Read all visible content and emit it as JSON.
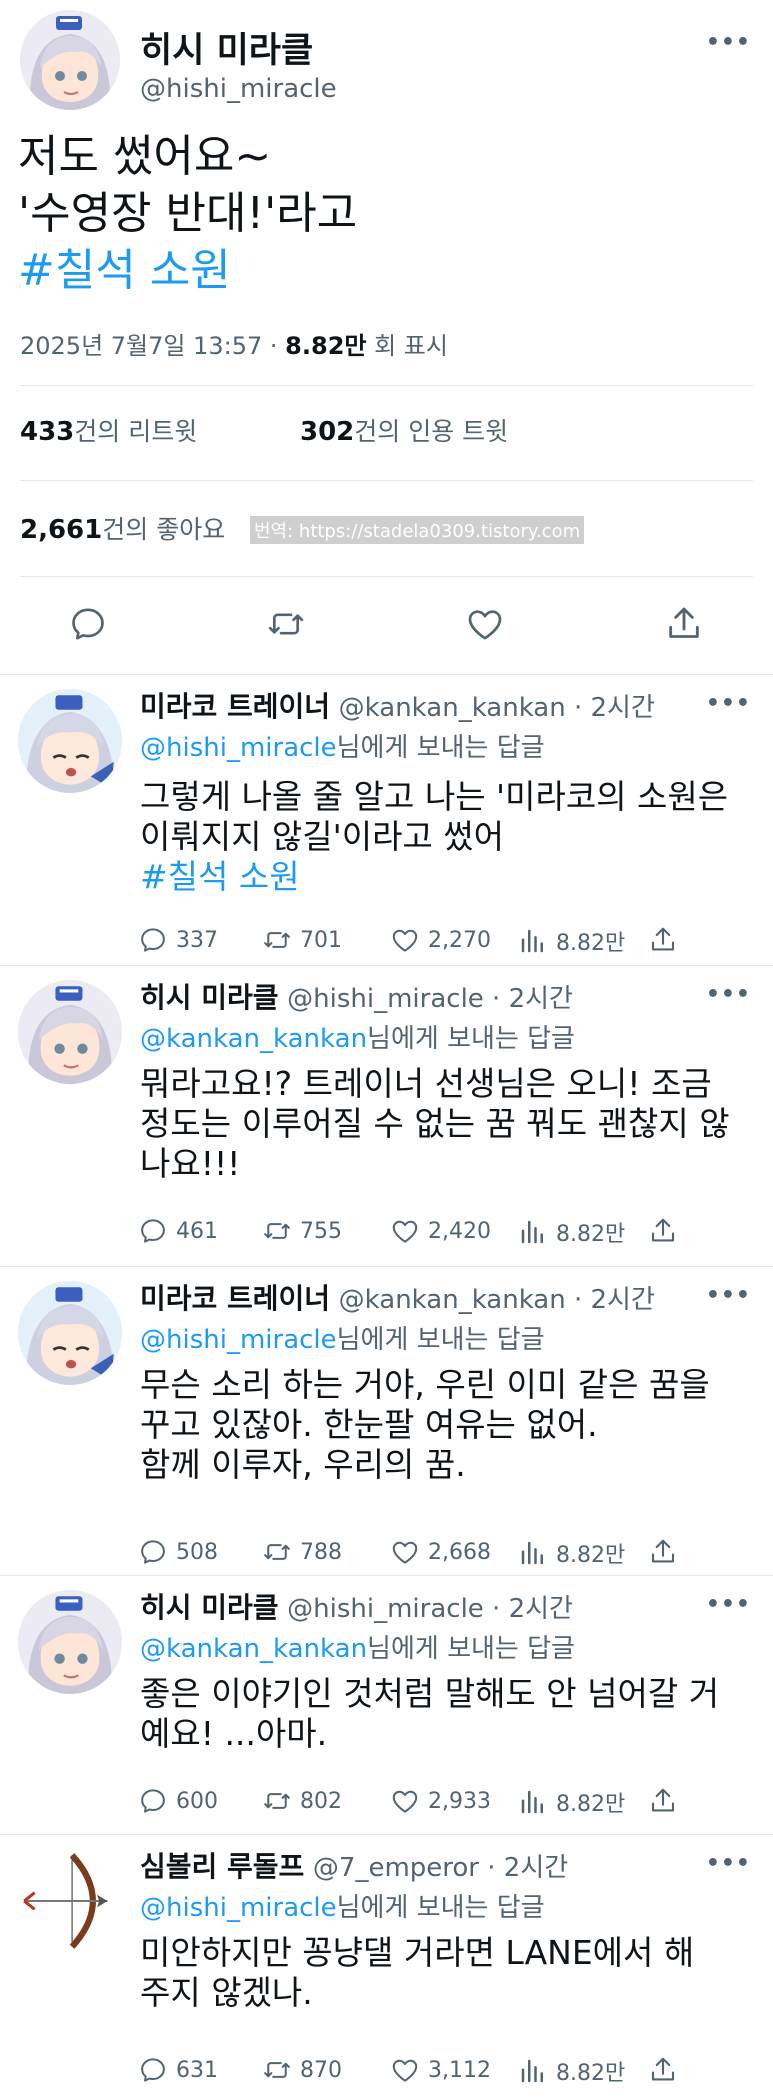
{
  "main_tweet": {
    "display_name": "히시 미라클",
    "handle": "@hishi_miracle",
    "more_label": "•••",
    "text": "저도 썼어요~\n'수영장 반대!'라고",
    "hashtag": "#칠석 소원",
    "timestamp": "2025년 7월7일 13:57 · ",
    "views": "8.82만",
    "views_suffix": " 회 표시",
    "retweets": "433",
    "retweets_label": "건의 리트윗",
    "quotes": "302",
    "quotes_label": "건의 인용 트윗",
    "likes": "2,661",
    "likes_label": "건의 좋아요",
    "watermark": "번역: https://stadela0309.tistory.com"
  },
  "replies": [
    {
      "display_name": "미라코 트레이너",
      "handle": "@kankan_kankan",
      "time": " · 2시간",
      "more_label": "•••",
      "mention": "@hishi_miracle",
      "replying_suffix": "님에게 보내는 답글",
      "text": "그렇게 나올 줄 알고 나는 '미라코의 소원은\n이뤄지지 않길'이라고 썼어",
      "hashtag": "#칠석 소원",
      "replies": "337",
      "retweets": "701",
      "likes": "2,270",
      "views": "8.82만",
      "avatar": "trainer"
    },
    {
      "display_name": "히시 미라클",
      "handle": "@hishi_miracle",
      "time": " · 2시간",
      "more_label": "•••",
      "mention": "@kankan_kankan",
      "replying_suffix": "님에게 보내는 답글",
      "text": "뭐라고요!? 트레이너 선생님은 오니! 조금\n정도는 이루어질 수 없는 꿈 꿔도 괜찮지 않\n나요!!!",
      "hashtag": "",
      "replies": "461",
      "retweets": "755",
      "likes": "2,420",
      "views": "8.82만",
      "avatar": "hishi"
    },
    {
      "display_name": "미라코 트레이너",
      "handle": "@kankan_kankan",
      "time": " · 2시간",
      "more_label": "•••",
      "mention": "@hishi_miracle",
      "replying_suffix": "님에게 보내는 답글",
      "text": "무슨 소리 하는 거야, 우린 이미 같은 꿈을\n꾸고 있잖아. 한눈팔 여유는 없어.\n함께 이루자, 우리의 꿈.",
      "hashtag": "",
      "replies": "508",
      "retweets": "788",
      "likes": "2,668",
      "views": "8.82만",
      "avatar": "trainer"
    },
    {
      "display_name": "히시 미라클",
      "handle": "@hishi_miracle",
      "time": " · 2시간",
      "more_label": "•••",
      "mention": "@kankan_kankan",
      "replying_suffix": "님에게 보내는 답글",
      "text": "좋은 이야기인 것처럼 말해도 안 넘어갈 거\n예요! ...아마.",
      "hashtag": "",
      "replies": "600",
      "retweets": "802",
      "likes": "2,933",
      "views": "8.82만",
      "avatar": "hishi"
    },
    {
      "display_name": "심볼리 루돌프",
      "handle": "@7_emperor",
      "time": " · 2시간",
      "more_label": "•••",
      "mention": "@hishi_miracle",
      "replying_suffix": "님에게 보내는 답글",
      "text": "미안하지만 꽁냥댈 거라면 LANE에서 해\n주지 않겠나.",
      "hashtag": "",
      "replies": "631",
      "retweets": "870",
      "likes": "3,112",
      "views": "8.82만",
      "avatar": "bow"
    }
  ],
  "colors": {
    "link": "#1d9bf0",
    "secondary": "#536471",
    "text": "#0f1419"
  }
}
